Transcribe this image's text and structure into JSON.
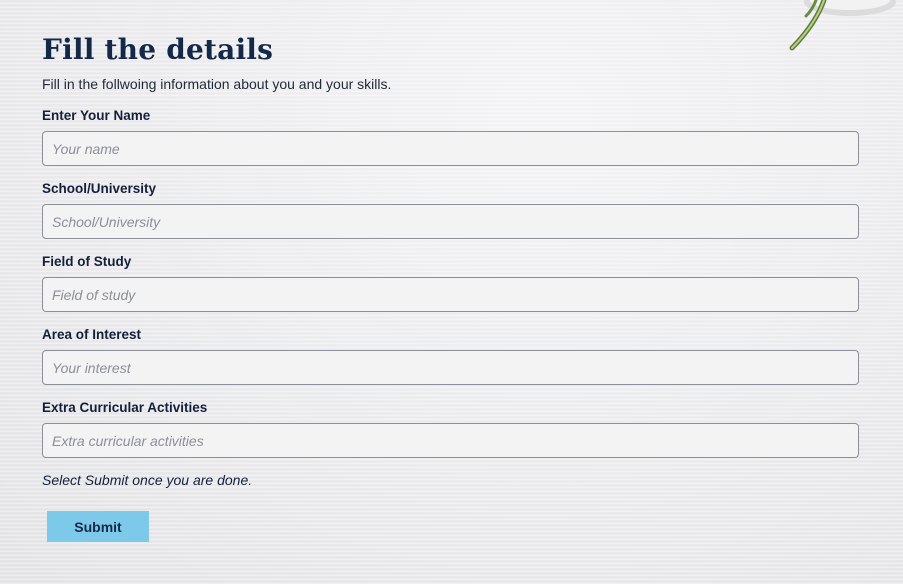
{
  "form": {
    "title": "Fill the details",
    "subtitle": "Fill in the follwoing information about you and your skills.",
    "fields": [
      {
        "label": "Enter Your Name",
        "placeholder": "Your name",
        "value": ""
      },
      {
        "label": "School/University",
        "placeholder": "School/University",
        "value": ""
      },
      {
        "label": "Field of Study",
        "placeholder": "Field of study",
        "value": ""
      },
      {
        "label": "Area of Interest",
        "placeholder": "Your interest",
        "value": ""
      },
      {
        "label": "Extra Curricular Activities",
        "placeholder": "Extra curricular activities",
        "value": ""
      }
    ],
    "note": "Select Submit once you are done.",
    "submit_label": "Submit"
  },
  "colors": {
    "title": "#14294a",
    "submit_bg": "#7dc9ea",
    "input_border": "#8a8f99"
  },
  "decor": {
    "corner_image": "potted-plant"
  }
}
